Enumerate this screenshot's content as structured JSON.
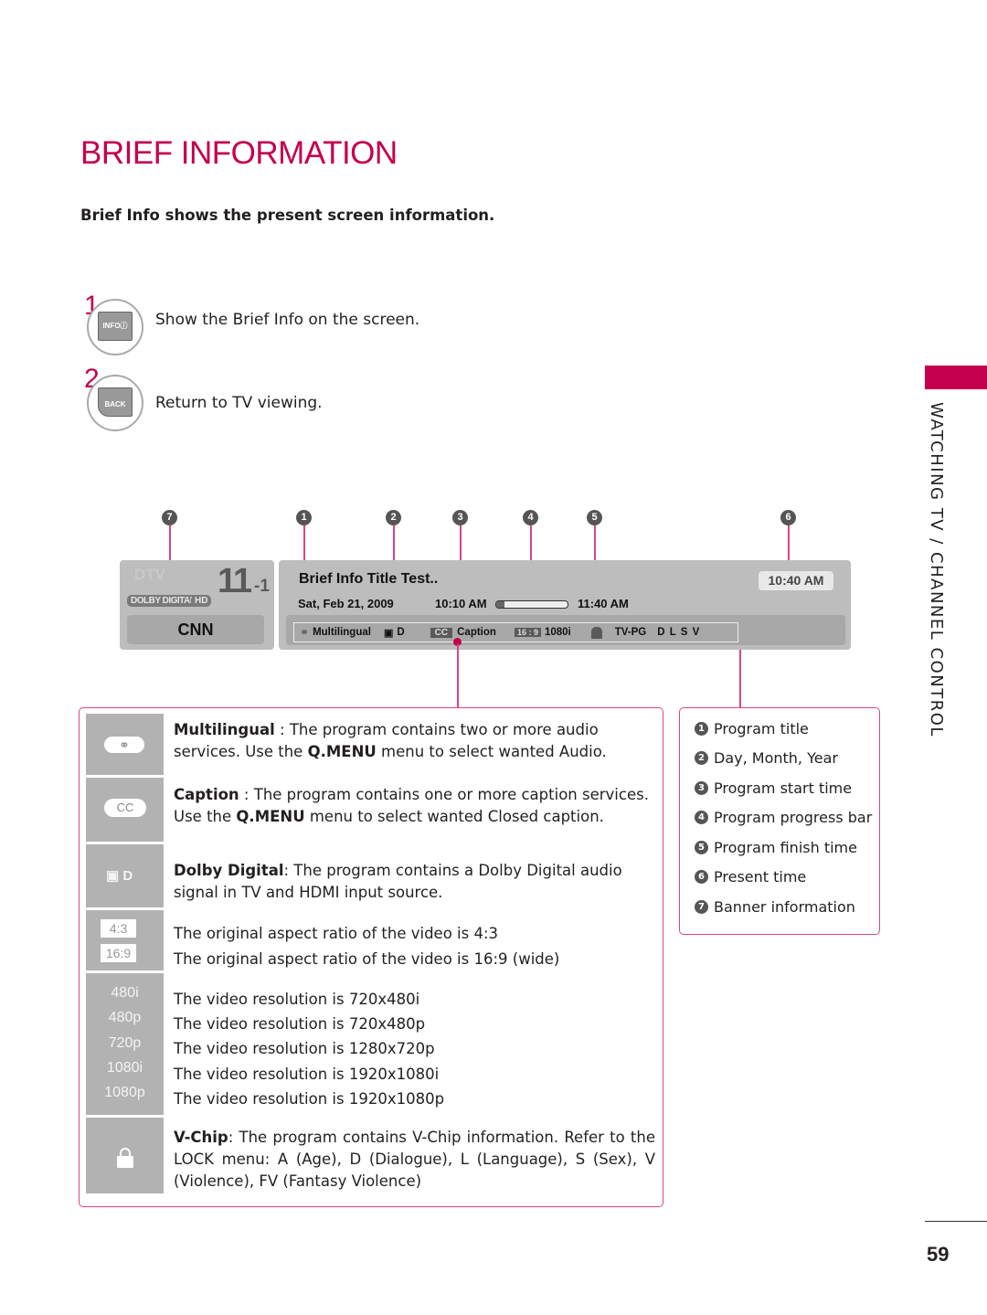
{
  "page": {
    "title": "BRIEF INFORMATION",
    "subtitle": "Brief Info shows the present screen information.",
    "section_label": "WATCHING TV / CHANNEL CONTROL",
    "page_number": "59"
  },
  "steps": [
    {
      "number": "1",
      "button_label": "INFOⓘ",
      "icon": "info-button-icon",
      "text": "Show the Brief Info on the screen."
    },
    {
      "number": "2",
      "button_label": "BACK",
      "icon": "back-button-icon",
      "text": "Return to TV viewing."
    }
  ],
  "callouts": [
    "7",
    "1",
    "2",
    "3",
    "4",
    "5",
    "6"
  ],
  "banner": {
    "source": "DTV",
    "channel_major": "11",
    "channel_minor": "-1",
    "badges": [
      "DOLBY DIGITAL",
      "HD"
    ],
    "station": "CNN",
    "program_title": "Brief Info Title Test..",
    "date": "Sat, Feb 21, 2009",
    "start_time": "10:10 AM",
    "end_time": "11:40 AM",
    "progress_fraction": 0.12,
    "present_time": "10:40 AM",
    "status": {
      "audio": "Multilingual",
      "dolby": "D",
      "cc_badge": "CC",
      "caption": "Caption",
      "aspect_badge": "16 : 9",
      "resolution": "1080i",
      "rating": "TV-PG",
      "rating_flags": "D L S V"
    }
  },
  "descriptions": [
    {
      "icon": "multilingual-icon",
      "bold": "Multilingual",
      "text_parts": [
        " : The program contains two or more audio services. Use the ",
        "Q.MENU",
        " menu to select wanted Audio."
      ]
    },
    {
      "icon": "cc-icon",
      "icon_label": "CC",
      "bold": "Caption",
      "text_parts": [
        " : The program contains one or more caption services. Use the ",
        "Q.MENU",
        " menu to select wanted Closed caption."
      ]
    },
    {
      "icon": "dolby-digital-icon",
      "icon_label": "D",
      "bold": "Dolby Digital",
      "text": ": The program contains a Dolby Digital audio signal in TV and HDMI input source."
    },
    {
      "icon_labels": [
        "4:3",
        "16:9"
      ],
      "lines": [
        "The original aspect ratio of the video is 4:3",
        "The original aspect ratio of the video is 16:9 (wide)"
      ]
    },
    {
      "icon_labels": [
        "480i",
        "480p",
        "720p",
        "1080i",
        "1080p"
      ],
      "lines": [
        "The video resolution is 720x480i",
        "The video resolution is 720x480p",
        "The video resolution is 1280x720p",
        "The video resolution is 1920x1080i",
        "The video resolution is 1920x1080p"
      ]
    },
    {
      "icon": "lock-icon",
      "bold": "V-Chip",
      "text": ": The program contains V-Chip information. Refer to the LOCK menu: A (Age), D (Dialogue), L (Language), S (Sex), V (Violence), FV (Fantasy Violence)"
    }
  ],
  "legend": [
    {
      "num": "1",
      "label": "Program title"
    },
    {
      "num": "2",
      "label": "Day, Month, Year"
    },
    {
      "num": "3",
      "label": "Program start time"
    },
    {
      "num": "4",
      "label": "Program progress bar"
    },
    {
      "num": "5",
      "label": "Program finish time"
    },
    {
      "num": "6",
      "label": "Present time"
    },
    {
      "num": "7",
      "label": "Banner information"
    }
  ],
  "colors": {
    "accent": "#c4004e",
    "panel": "#bdbdbd",
    "icon_cell": "#b2b2b2"
  }
}
